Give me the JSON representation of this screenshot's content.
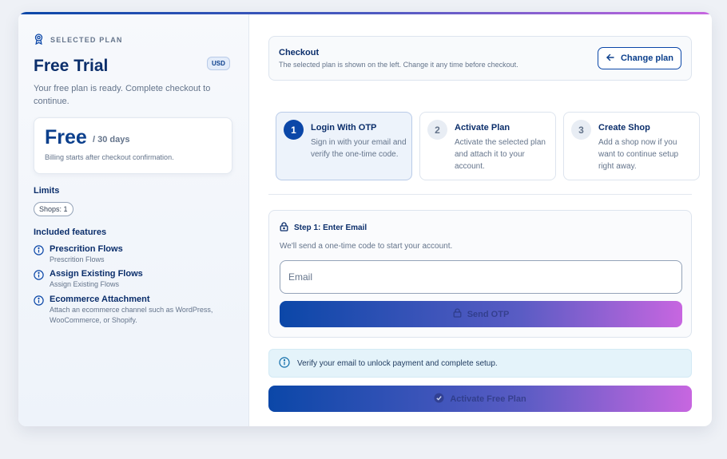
{
  "plan": {
    "section_label": "SELECTED PLAN",
    "section_icon": "award-icon",
    "title": "Free Trial",
    "currency": "USD",
    "description": "Your free plan is ready. Complete checkout to continue.",
    "price": "Free",
    "period": "/ 30 days",
    "billing_note": "Billing starts after checkout confirmation."
  },
  "limits": {
    "heading": "Limits",
    "chips": [
      "Shops: 1"
    ]
  },
  "features": {
    "heading": "Included features",
    "icon": "info-circle-icon",
    "items": [
      {
        "name": "Prescrition Flows",
        "desc": "Prescrition Flows"
      },
      {
        "name": "Assign Existing Flows",
        "desc": "Assign Existing Flows"
      },
      {
        "name": "Ecommerce Attachment",
        "desc": "Attach an ecommerce channel such as WordPress, WooCommerce, or Shopify."
      }
    ]
  },
  "checkout": {
    "title": "Checkout",
    "subtitle": "The selected plan is shown on the left. Change it any time before checkout.",
    "change_label": "Change plan",
    "change_icon": "arrow-left-icon"
  },
  "steps": [
    {
      "num": "1",
      "title": "Login With OTP",
      "desc": "Sign in with your email and verify the one-time code.",
      "active": true
    },
    {
      "num": "2",
      "title": "Activate Plan",
      "desc": "Activate the selected plan and attach it to your account.",
      "active": false
    },
    {
      "num": "3",
      "title": "Create Shop",
      "desc": "Add a shop now if you want to continue setup right away.",
      "active": false
    }
  ],
  "form": {
    "heading": "Step 1: Enter Email",
    "heading_icon": "lock-icon",
    "description": "We'll send a one-time code to start your account.",
    "email_placeholder": "Email",
    "send_label": "Send OTP"
  },
  "info": {
    "text": "Verify your email to unlock payment and complete setup.",
    "icon": "info-circle-icon"
  },
  "activate": {
    "label": "Activate Free Plan",
    "icon": "check-circle-icon"
  },
  "colors": {
    "primary": "#0b47a8",
    "accent": "#c766e0",
    "heading": "#0b2e6b",
    "muted": "#64748b",
    "info_bg": "#e4f3fa"
  }
}
